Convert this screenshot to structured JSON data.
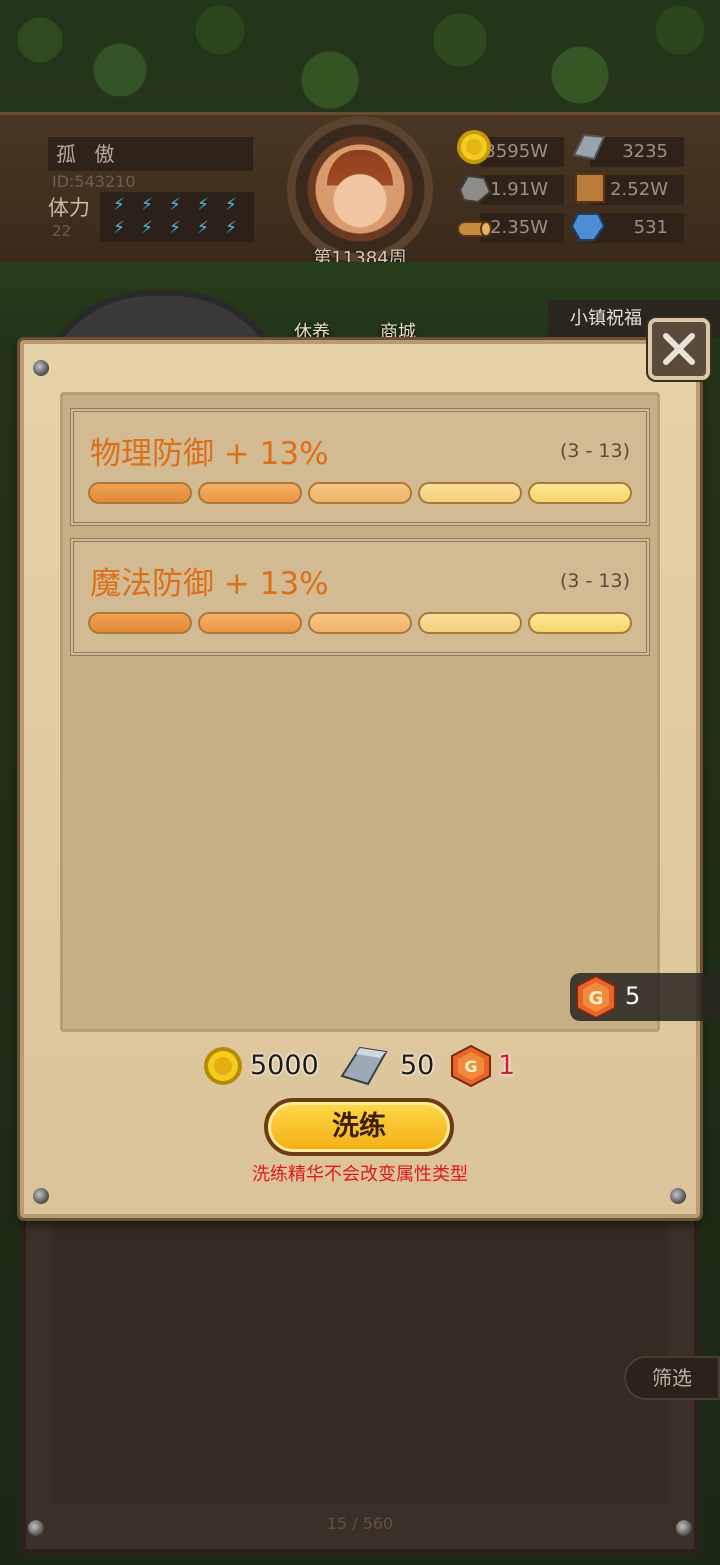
{
  "hud": {
    "player_name": "孤 傲",
    "player_id": "ID:543210",
    "stamina_label": "体力",
    "stamina_value": "22",
    "week_label": "第11384周",
    "resources": {
      "gold": "3595W",
      "iron": "3235",
      "stone": "1.91W",
      "leather": "2.52W",
      "wood": "2.35W",
      "crystal": "531"
    }
  },
  "nav": {
    "btn_1": "休养",
    "btn_2": "商城",
    "town_blessing": "小镇祝福"
  },
  "dialog": {
    "stats": [
      {
        "name": "物理防御 + 13%",
        "range": "(3 - 13)",
        "segments": 5
      },
      {
        "name": "魔法防御 + 13%",
        "range": "(3 - 13)",
        "segments": 5
      }
    ],
    "essence_owned": "5",
    "cost": {
      "gold": "5000",
      "iron": "50",
      "essence": "1"
    },
    "refine_button": "洗练",
    "refine_note": "洗练精华不会改变属性类型"
  },
  "inventory": {
    "filter_button": "筛选",
    "page_count": "15 / 560"
  },
  "colors": {
    "stat_text": "#dc6f1a",
    "note_text": "#e21919",
    "button_gold": "#f2ad12"
  },
  "icons": [
    "gold-coin-icon",
    "iron-ingot-icon",
    "stone-icon",
    "leather-icon",
    "wood-log-icon",
    "crystal-icon",
    "lightning-icon",
    "essence-gem-icon",
    "close-icon"
  ]
}
